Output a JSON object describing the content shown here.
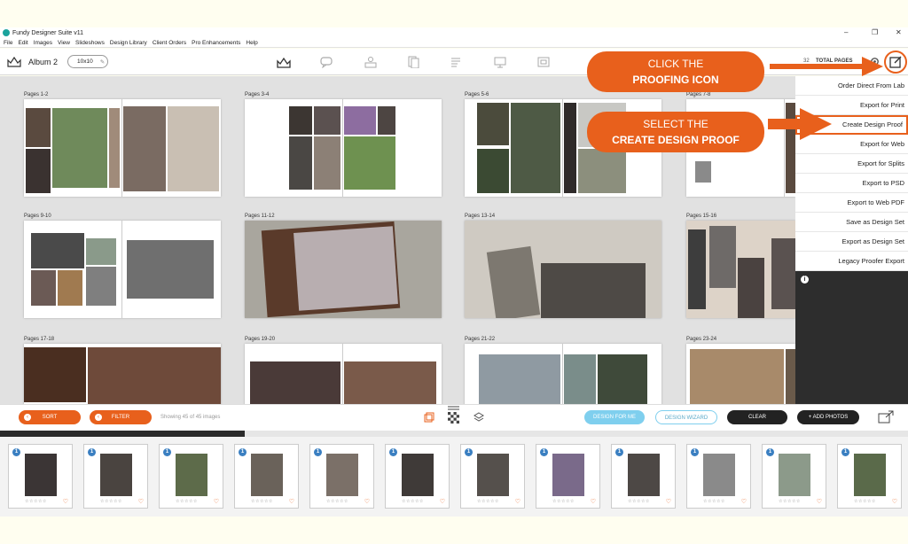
{
  "app": {
    "title": "Fundy Designer Suite v11"
  },
  "window_controls": {
    "minimize": "–",
    "maximize": "❐",
    "close": "✕"
  },
  "menu": [
    "File",
    "Edit",
    "Images",
    "View",
    "Slideshows",
    "Design Library",
    "Client Orders",
    "Pro Enhancements",
    "Help"
  ],
  "toolbar": {
    "album_name": "Album 2",
    "album_size": "10x10",
    "total_pages": "32",
    "total_pages_label": "TOTAL PAGES"
  },
  "spreads": [
    {
      "label": "Pages 1-2"
    },
    {
      "label": "Pages 3-4"
    },
    {
      "label": "Pages 5-6"
    },
    {
      "label": "Pages 7-8"
    },
    {
      "label": "Pages 9-10"
    },
    {
      "label": "Pages 11-12"
    },
    {
      "label": "Pages 13-14"
    },
    {
      "label": "Pages 15-16"
    },
    {
      "label": "Pages 17-18"
    },
    {
      "label": "Pages 19-20"
    },
    {
      "label": "Pages 21-22"
    },
    {
      "label": "Pages 23-24"
    }
  ],
  "export_menu": [
    "Order Direct From Lab",
    "Export for Print",
    "Create Design Proof",
    "Export for Web",
    "Export for Splits",
    "Export to PSD",
    "Export to Web PDF",
    "Save as Design Set",
    "Export as Design Set",
    "Legacy Proofer Export"
  ],
  "callouts": {
    "one_line1": "CLICK THE",
    "one_line2": "PROOFING ICON",
    "two_line1": "SELECT THE",
    "two_line2": "CREATE DESIGN PROOF"
  },
  "bottombar": {
    "sort": "SORT",
    "filter": "FILTER",
    "showing": "Showing 45 of 45 images",
    "design_for_me": "DESIGN FOR ME",
    "design_wizard": "DESIGN WIZARD",
    "clear": "CLEAR",
    "add_photos": "+ ADD PHOTOS"
  },
  "progress_fraction": 0.27,
  "thumbnails": {
    "count": 12,
    "badge": "1",
    "stars": "☆☆☆☆☆",
    "heart": "♡"
  }
}
